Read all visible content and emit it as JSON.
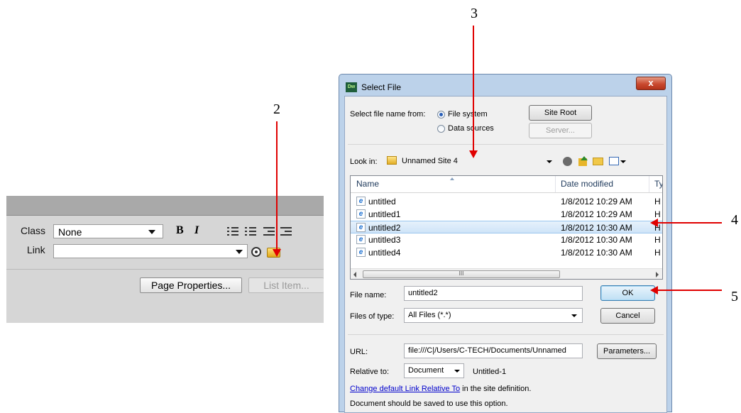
{
  "property_inspector": {
    "class_label": "Class",
    "class_value": "None",
    "bold_label": "B",
    "italic_label": "I",
    "link_label": "Link",
    "link_value": "",
    "page_properties_label": "Page Properties...",
    "list_item_label": "List Item..."
  },
  "dialog": {
    "title": "Select File",
    "logo_text": "Dw",
    "close_label": "x",
    "select_from_label": "Select file name from:",
    "radio_file_system": "File system",
    "radio_data_sources": "Data sources",
    "site_root_label": "Site Root",
    "server_label": "Server...",
    "look_in_label": "Look in:",
    "look_in_value": "Unnamed Site 4",
    "columns": {
      "name": "Name",
      "date": "Date modified",
      "type": "Ty"
    },
    "files": [
      {
        "name": "untitled",
        "date": "1/8/2012 10:29 AM",
        "type": "H",
        "selected": false
      },
      {
        "name": "untitled1",
        "date": "1/8/2012 10:29 AM",
        "type": "H",
        "selected": false
      },
      {
        "name": "untitled2",
        "date": "1/8/2012 10:30 AM",
        "type": "H",
        "selected": true
      },
      {
        "name": "untitled3",
        "date": "1/8/2012 10:30 AM",
        "type": "H",
        "selected": false
      },
      {
        "name": "untitled4",
        "date": "1/8/2012 10:30 AM",
        "type": "H",
        "selected": false
      }
    ],
    "scroll_grip": "III",
    "file_name_label": "File name:",
    "file_name_value": "untitled2",
    "ok_label": "OK",
    "files_of_type_label": "Files of type:",
    "files_of_type_value": "All Files (*.*)",
    "cancel_label": "Cancel",
    "url_label": "URL:",
    "url_value": "file:///C|/Users/C-TECH/Documents/Unnamed",
    "parameters_label": "Parameters...",
    "relative_to_label": "Relative to:",
    "relative_to_value": "Document",
    "relative_doc_name": "Untitled-1",
    "change_link_text": "Change default Link Relative To",
    "change_link_suffix": " in the site definition.",
    "note_text": "Document should be saved to use this option."
  },
  "annotations": [
    "2",
    "3",
    "4",
    "5"
  ],
  "colors": {
    "arrow": "#e00000",
    "link": "#0000cc",
    "selection": "#cfe4f8"
  }
}
